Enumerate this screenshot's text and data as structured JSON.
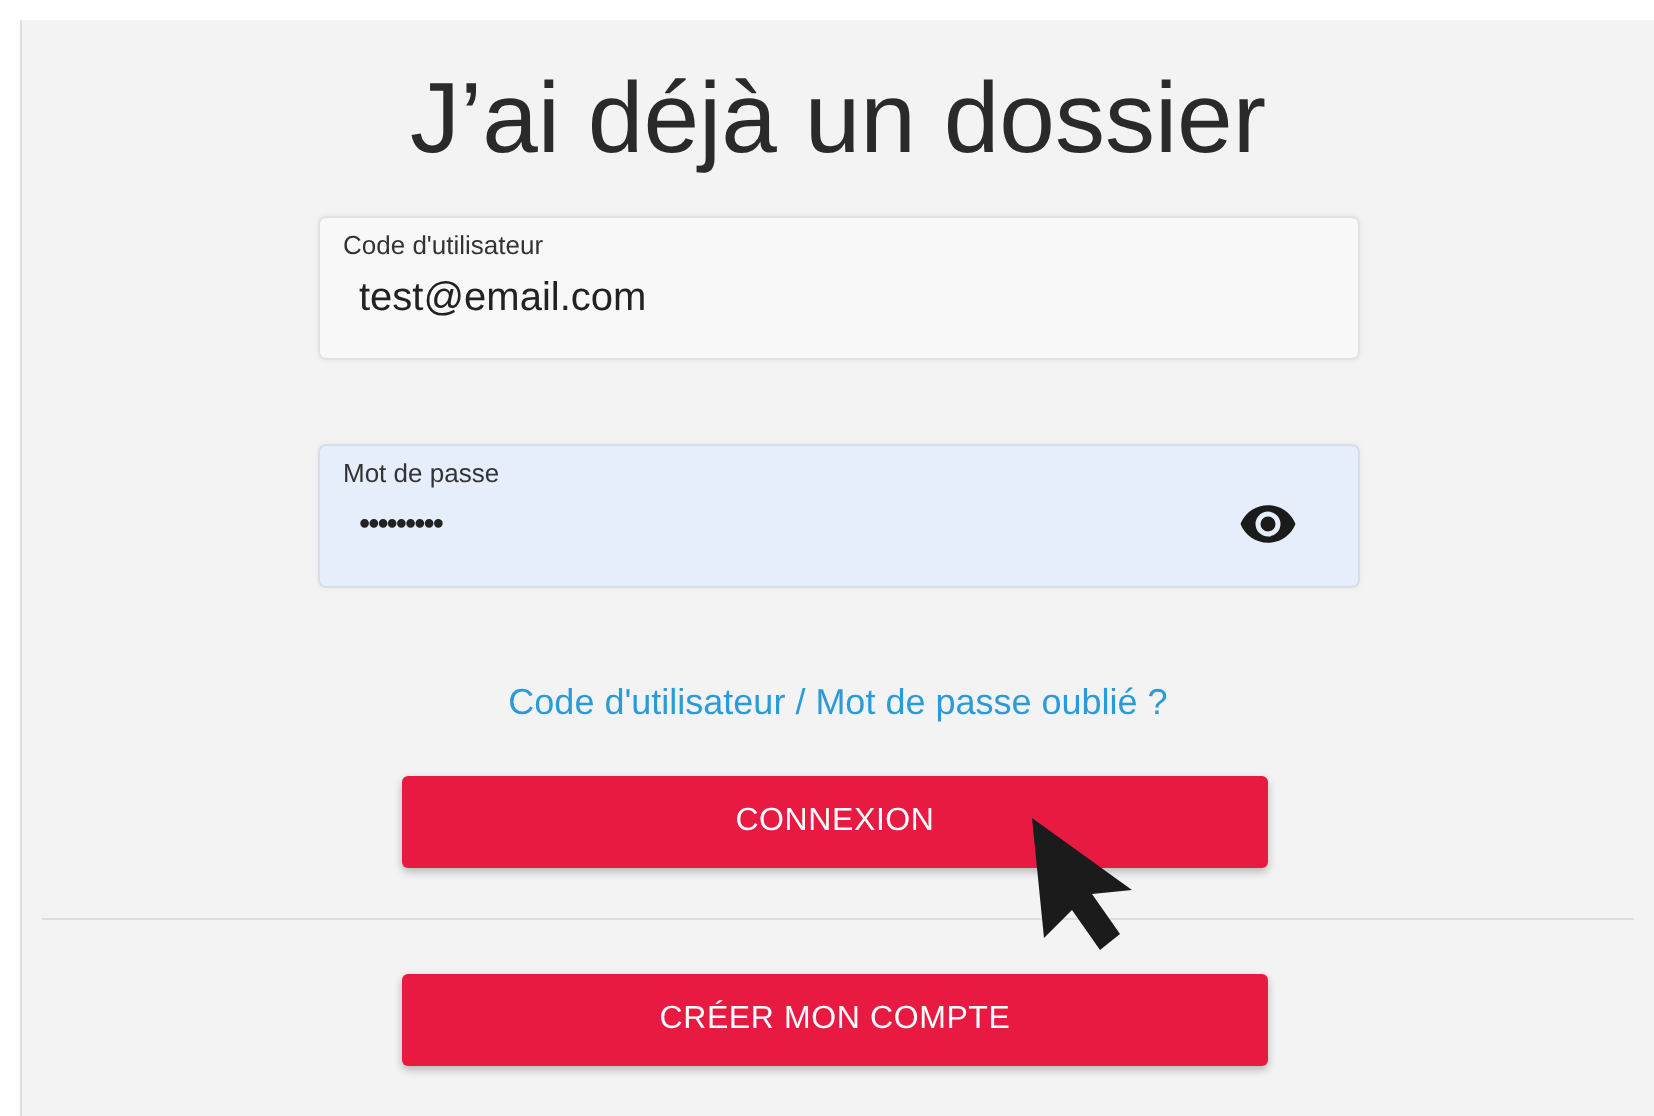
{
  "title": "J’ai déjà un dossier",
  "fields": [
    {
      "label": "Code d'utilisateur",
      "value": "test@email.com",
      "kind": "text",
      "autofilled": false
    },
    {
      "label": "Mot de passe",
      "value": "•••••••••",
      "kind": "password",
      "autofilled": true
    }
  ],
  "forgot_link": "Code d'utilisateur / Mot de passe oublié ?",
  "buttons": [
    "CONNEXION",
    "CRÉER MON COMPTE"
  ]
}
